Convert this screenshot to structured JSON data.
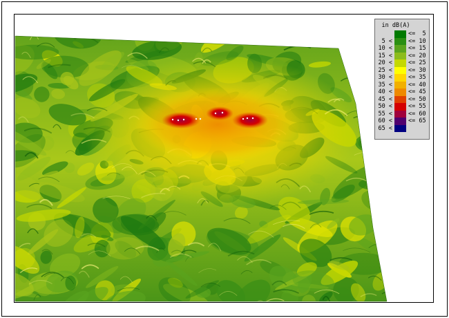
{
  "legend": {
    "title": "in dB(A)",
    "bands": [
      {
        "low": "",
        "high": "<=  5",
        "color": "#007a00"
      },
      {
        "low": "5 <",
        "high": "<= 10",
        "color": "#2a8f12"
      },
      {
        "low": "10 <",
        "high": "<= 15",
        "color": "#5aa41e"
      },
      {
        "low": "15 <",
        "high": "<= 20",
        "color": "#8cbc1c"
      },
      {
        "low": "20 <",
        "high": "<= 25",
        "color": "#c4d800"
      },
      {
        "low": "25 <",
        "high": "<= 30",
        "color": "#ffff00"
      },
      {
        "low": "30 <",
        "high": "<= 35",
        "color": "#ffd600"
      },
      {
        "low": "35 <",
        "high": "<= 40",
        "color": "#f2b000"
      },
      {
        "low": "40 <",
        "high": "<= 45",
        "color": "#ee8a00"
      },
      {
        "low": "45 <",
        "high": "<= 50",
        "color": "#e04000"
      },
      {
        "low": "50 <",
        "high": "<= 55",
        "color": "#d40000"
      },
      {
        "low": "55 <",
        "high": "<= 60",
        "color": "#a0003c"
      },
      {
        "low": "60 <",
        "high": "<= 65",
        "color": "#50006e"
      },
      {
        "low": "65 <",
        "high": "",
        "color": "#000080"
      }
    ]
  }
}
